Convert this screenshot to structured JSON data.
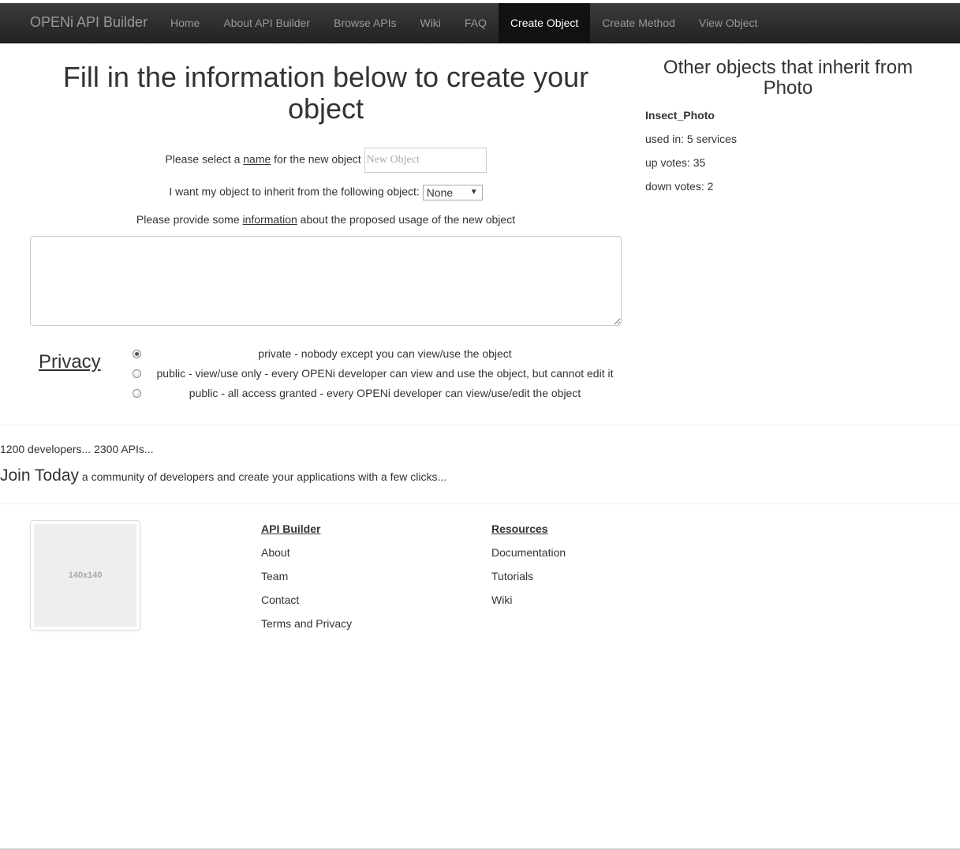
{
  "navbar": {
    "brand": "OPENi API Builder",
    "items": [
      {
        "label": "Home"
      },
      {
        "label": "About API Builder"
      },
      {
        "label": "Browse APIs"
      },
      {
        "label": "Wiki"
      },
      {
        "label": "FAQ"
      },
      {
        "label": "Create Object",
        "active": true
      },
      {
        "label": "Create Method"
      },
      {
        "label": "View Object"
      }
    ]
  },
  "form": {
    "title": "Fill in the information below to create your object",
    "name_prefix": "Please select a ",
    "name_link": "name",
    "name_suffix": " for the new object",
    "name_placeholder": "New Object",
    "inherit_label": "I want my object to inherit from the following object:",
    "inherit_value": "None",
    "info_prefix": "Please provide some ",
    "info_link": "information",
    "info_suffix": " about the proposed usage of the new object",
    "privacy_label": "Privacy",
    "privacy_options": [
      {
        "label": "private - nobody except you can view/use the object",
        "checked": true
      },
      {
        "label": "public - view/use only - every OPENi developer can view and use the object, but cannot edit it",
        "checked": false
      },
      {
        "label": "public - all access granted - every OPENi developer can view/use/edit the object",
        "checked": false
      }
    ]
  },
  "sidebar": {
    "title": "Other objects that inherit from Photo",
    "object_name": "Insect_Photo",
    "used_in": "used in: 5 services",
    "up_votes": "up votes: 35",
    "down_votes": "down votes: 2"
  },
  "promo": {
    "stats": "1200 developers... 2300 APIs...",
    "join_big": "Join Today",
    "join_small": " a community of developers and create your applications with a few clicks..."
  },
  "footer": {
    "thumb_label": "140x140",
    "api_builder": {
      "heading": "API Builder",
      "links": [
        "About",
        "Team",
        "Contact",
        "Terms and Privacy"
      ]
    },
    "resources": {
      "heading": "Resources",
      "links": [
        "Documentation",
        "Tutorials",
        "Wiki"
      ]
    }
  }
}
